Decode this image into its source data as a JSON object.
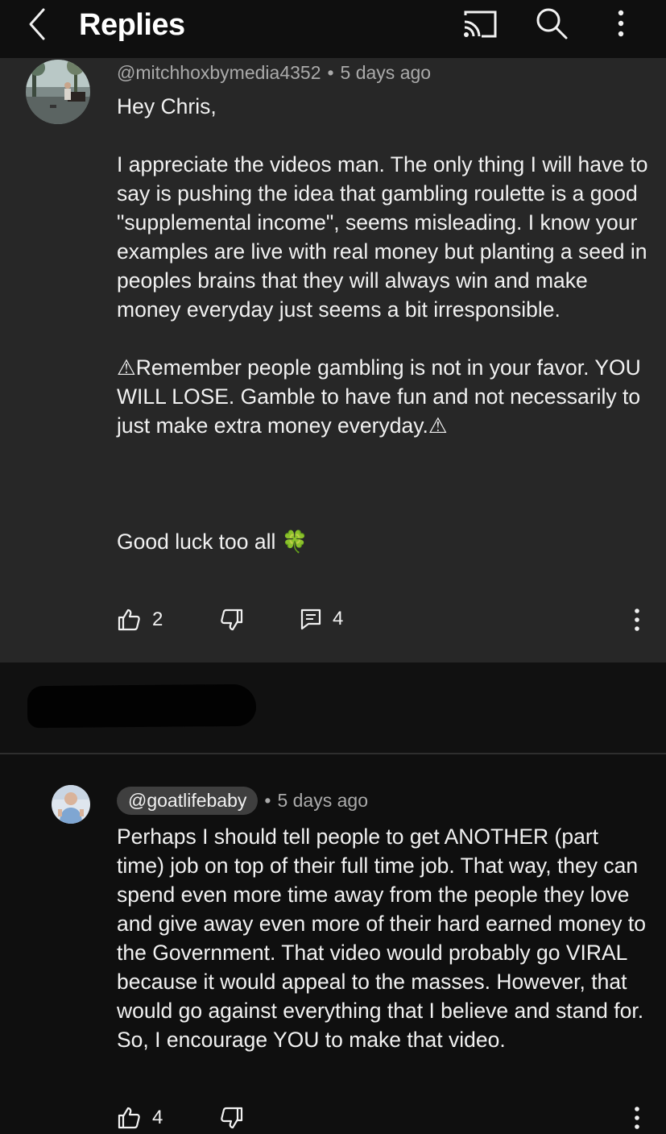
{
  "header": {
    "title": "Replies",
    "icons": [
      "back-icon",
      "cast-icon",
      "search-icon",
      "more-vertical-icon"
    ]
  },
  "parent_comment": {
    "handle": "@mitchhoxbymedia4352",
    "separator": "•",
    "time": "5 days ago",
    "text": "Hey Chris,\n\nI appreciate the videos man. The only thing I will have to say is pushing the idea that gambling roulette is a good \"supplemental income\", seems misleading. I know your examples are live with real money but planting a seed in peoples brains that they will always win and make money everyday just seems a bit irresponsible.\n\n⚠Remember people gambling is not in your favor. YOU WILL LOSE. Gamble to have fun and not necessarily to just make extra money everyday.⚠\n\n\n\nGood luck too all 🍀",
    "likes": "2",
    "replies": "4"
  },
  "reply": {
    "handle": "@goatlifebaby",
    "separator": "•",
    "time": "5 days ago",
    "text": "Perhaps I should tell people to get ANOTHER (part time) job on top of their full time job. That way, they can spend even more time away from the people they love and give away even more of their hard earned money to the Government. That video would probably go VIRAL because it would appeal to the masses. However, that would go against everything that I believe and stand for. So, I encourage YOU to make that video.",
    "likes": "4"
  },
  "colors": {
    "background": "#0f0f0f",
    "parent_background": "#272727",
    "text": "#f1f1f1",
    "muted": "#aaaaaa",
    "chip": "#3f3f3f"
  }
}
